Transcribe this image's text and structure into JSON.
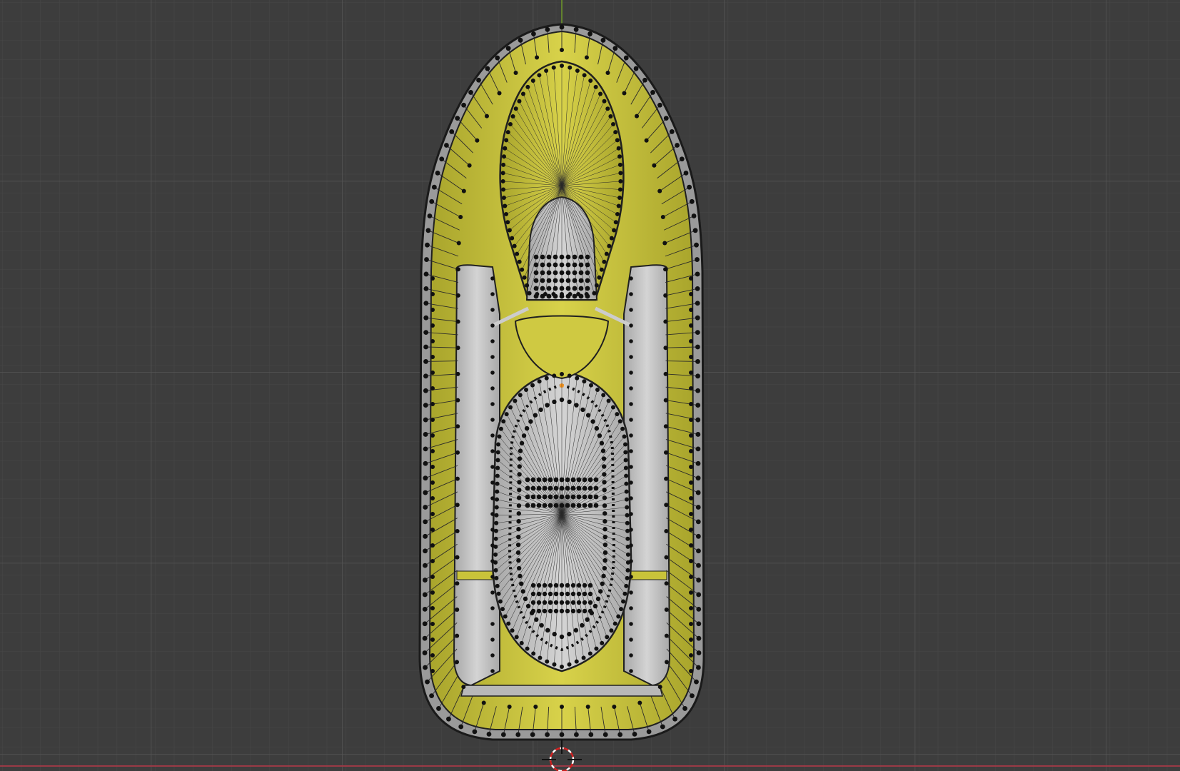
{
  "app": {
    "name": "",
    "view": "top-orthographic",
    "mode": "edit-mode"
  },
  "viewport": {
    "background": "#3d3d3d",
    "grid_minor_color": "#464646",
    "grid_major_color": "#525252",
    "x_axis_color": "#9a3a45",
    "y_axis_color": "#6e9a2a"
  },
  "object": {
    "type": "jet-ski-mesh",
    "selected_face_color": "#c9c33a",
    "selected_face_shadow": "#8f8a22",
    "unselected_face_color": "#c6c6c6",
    "edge_color": "#202020",
    "vertex_color": "#111111"
  },
  "cursor": {
    "name": "3d-cursor"
  }
}
